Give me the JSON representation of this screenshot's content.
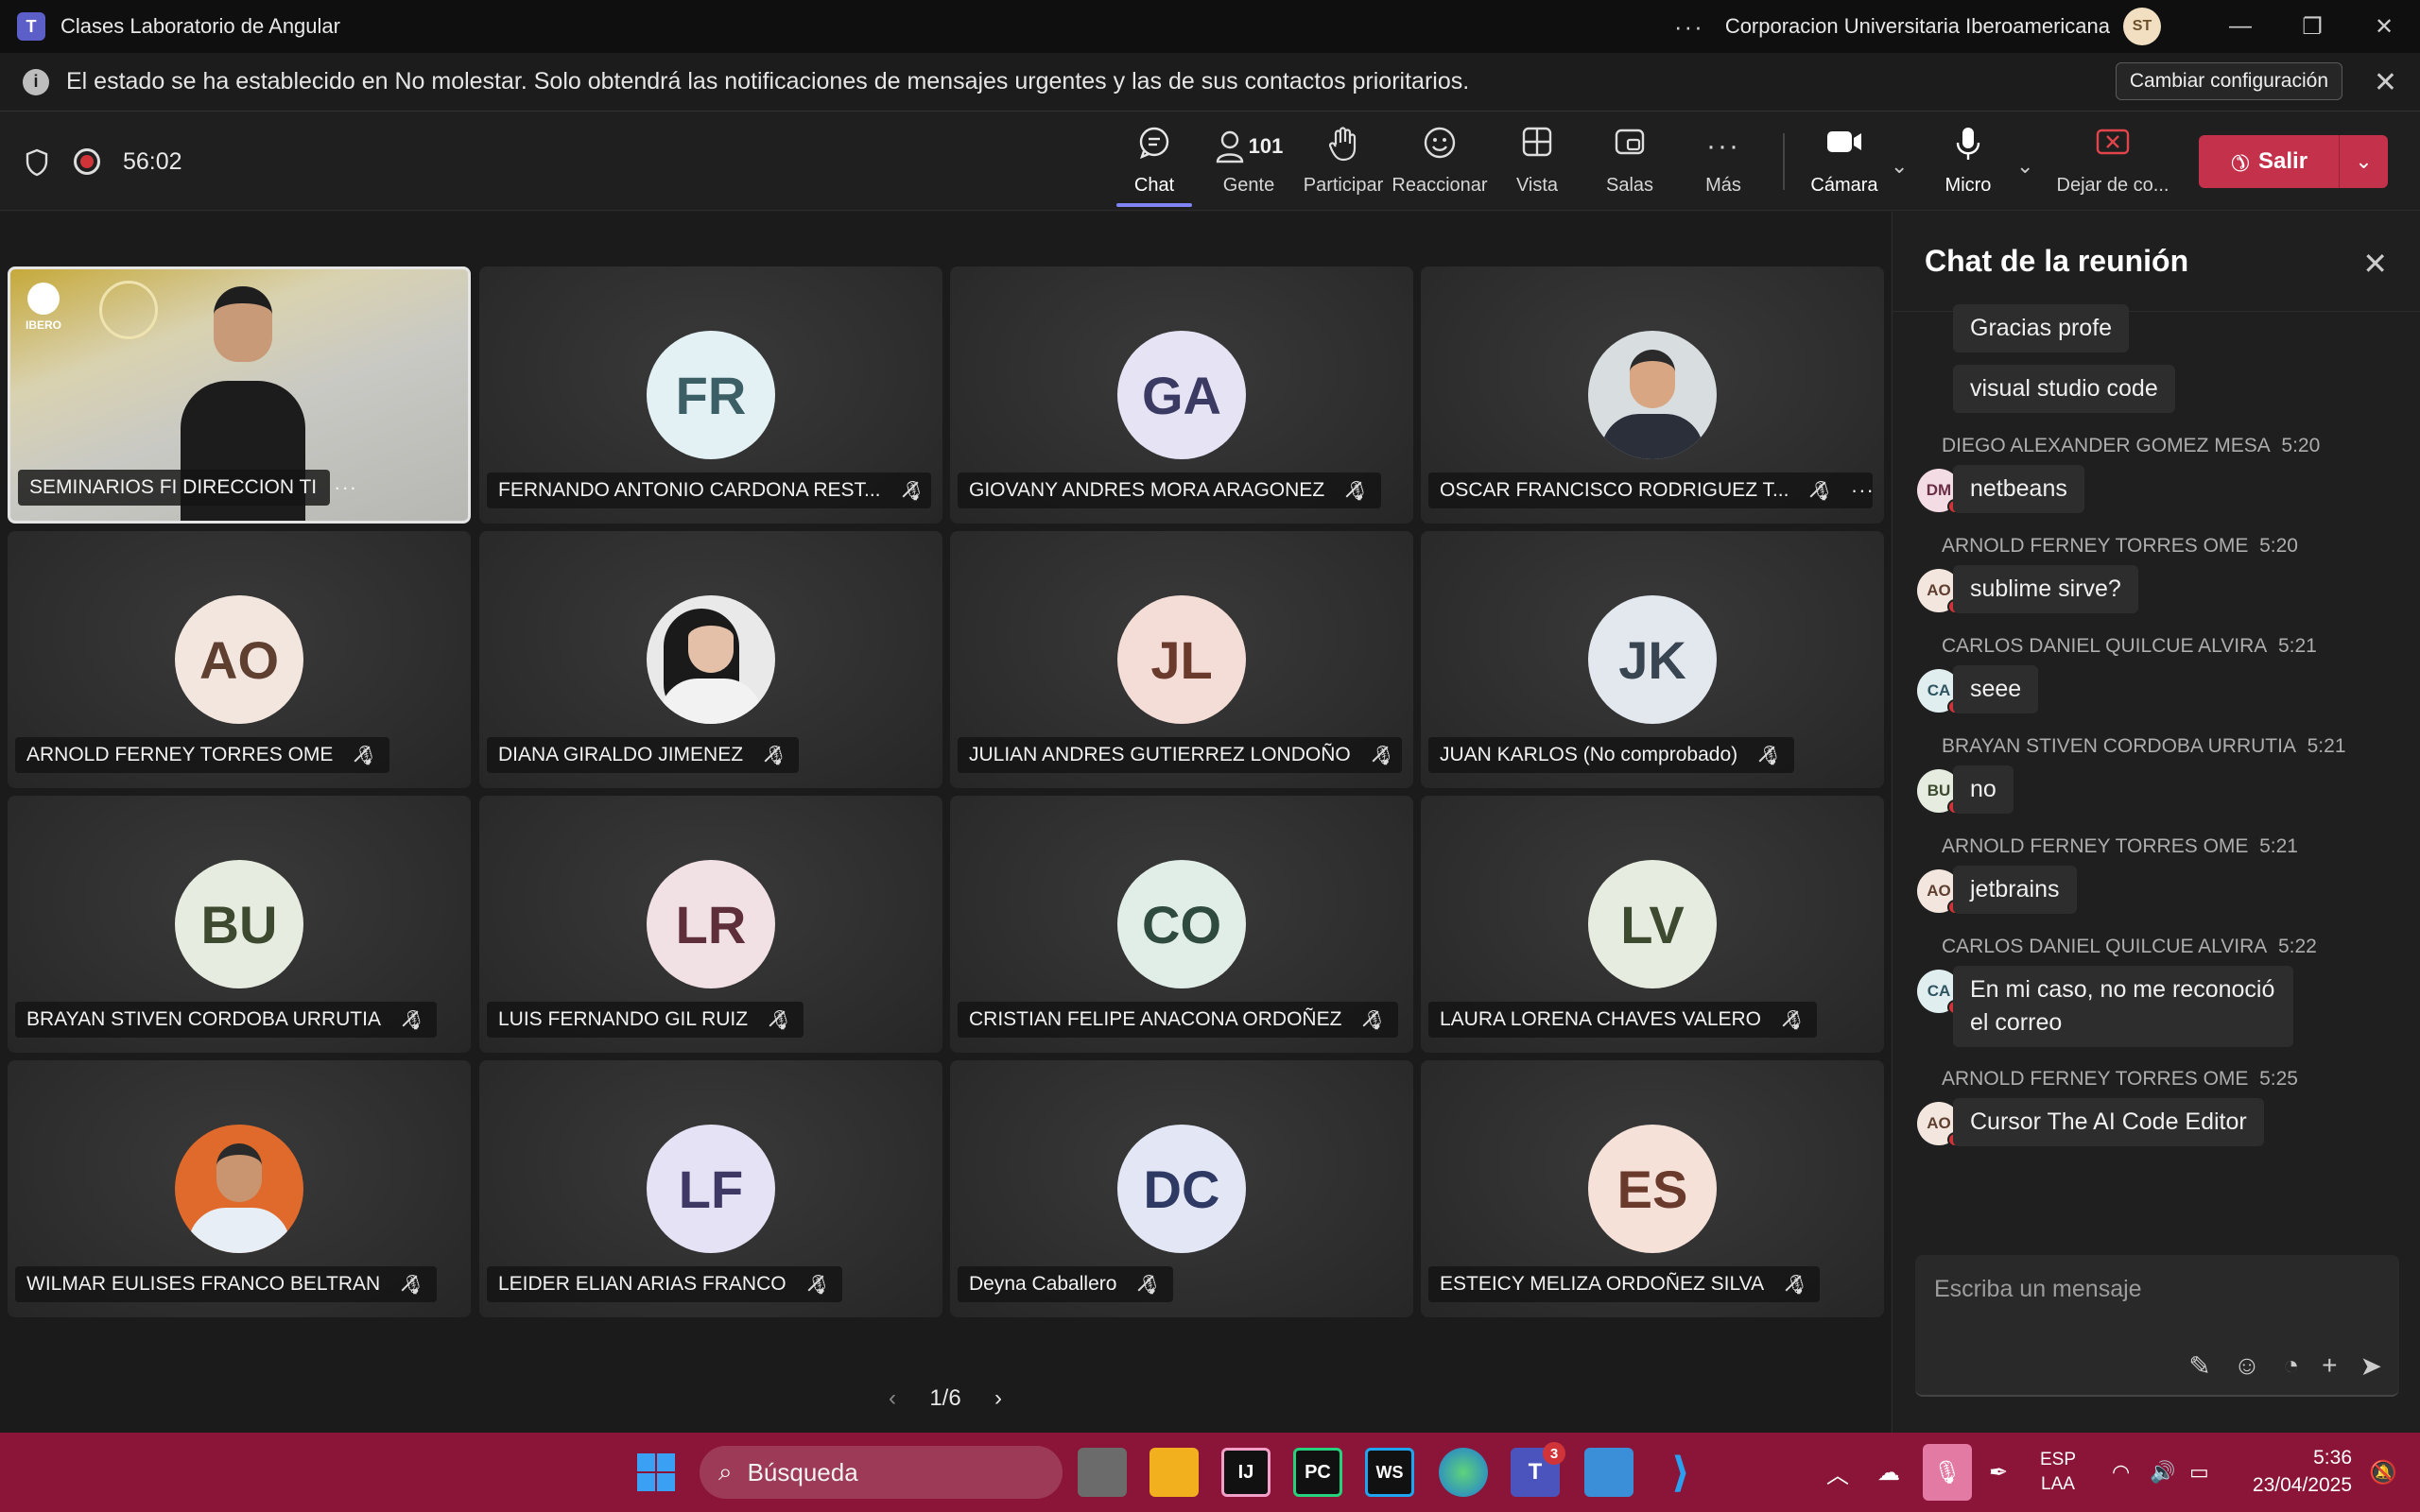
{
  "window": {
    "app_title": "Clases Laboratorio de Angular",
    "more": "···",
    "org": "Corporacion Universitaria Iberoamericana",
    "user_initials": "ST",
    "minimize": "—",
    "restore": "❐",
    "close": "✕"
  },
  "notice": {
    "text": "El estado se ha establecido en No molestar. Solo obtendrá las notificaciones de mensajes urgentes y las de sus contactos prioritarios.",
    "button": "Cambiar configuración",
    "close": "✕"
  },
  "toolbar": {
    "timer": "56:02",
    "chat": "Chat",
    "people": "Gente",
    "people_count": "101",
    "raise": "Participar",
    "react": "Reaccionar",
    "view": "Vista",
    "rooms": "Salas",
    "more": "Más",
    "camera": "Cámara",
    "mic": "Micro",
    "share": "Dejar de co...",
    "leave": "Salir"
  },
  "participants": [
    {
      "name": "SEMINARIOS FI DIRECCION TI",
      "initials": "",
      "photo": "room",
      "mic_off": false,
      "more": true
    },
    {
      "name": "FERNANDO ANTONIO CARDONA REST...",
      "initials": "FR",
      "bg": "#e3f1f4",
      "fg": "#3c5f66",
      "mic_off": true
    },
    {
      "name": "GIOVANY ANDRES MORA ARAGONEZ",
      "initials": "GA",
      "bg": "#e5e3f4",
      "fg": "#3b3a63",
      "mic_off": true
    },
    {
      "name": "OSCAR FRANCISCO RODRIGUEZ T...",
      "initials": "",
      "photo": "man-suit",
      "mic_off": true,
      "more": true
    },
    {
      "name": "ARNOLD FERNEY TORRES OME",
      "initials": "AO",
      "bg": "#f3e6de",
      "fg": "#5f3f30",
      "mic_off": true
    },
    {
      "name": "DIANA GIRALDO JIMENEZ",
      "initials": "",
      "photo": "woman",
      "mic_off": true
    },
    {
      "name": "JULIAN ANDRES GUTIERREZ LONDOÑO",
      "initials": "JL",
      "bg": "#f4ddd6",
      "fg": "#6a3a2c",
      "mic_off": true
    },
    {
      "name": "JUAN KARLOS (No comprobado)",
      "initials": "JK",
      "bg": "#e2e8ee",
      "fg": "#3a4552",
      "mic_off": true
    },
    {
      "name": "BRAYAN STIVEN CORDOBA URRUTIA",
      "initials": "BU",
      "bg": "#e6ecdf",
      "fg": "#3d4a2f",
      "mic_off": true
    },
    {
      "name": "LUIS FERNANDO GIL RUIZ",
      "initials": "LR",
      "bg": "#f1e0e4",
      "fg": "#5e2f3b",
      "mic_off": true
    },
    {
      "name": "CRISTIAN FELIPE ANACONA ORDOÑEZ",
      "initials": "CO",
      "bg": "#e1eee8",
      "fg": "#2f4a3f",
      "mic_off": true
    },
    {
      "name": "LAURA LORENA CHAVES VALERO",
      "initials": "LV",
      "bg": "#e6ecdf",
      "fg": "#3d4a2f",
      "mic_off": true
    },
    {
      "name": "WILMAR EULISES FRANCO BELTRAN",
      "initials": "",
      "photo": "man-orange",
      "mic_off": true
    },
    {
      "name": "LEIDER ELIAN ARIAS FRANCO",
      "initials": "LF",
      "bg": "#e6e2f6",
      "fg": "#3e3865",
      "mic_off": true
    },
    {
      "name": "Deyna Caballero",
      "initials": "DC",
      "bg": "#e2e6f5",
      "fg": "#2e3a63",
      "mic_off": true
    },
    {
      "name": "ESTEICY MELIZA ORDOÑEZ SILVA",
      "initials": "ES",
      "bg": "#f5e1d8",
      "fg": "#6a3a2c",
      "mic_off": true
    }
  ],
  "pager": {
    "label": "1/6",
    "prev": "‹",
    "next": "›"
  },
  "chat": {
    "title": "Chat de la reunión",
    "close": "✕",
    "messages": [
      {
        "text": "Gracias profe"
      },
      {
        "text": "visual studio code"
      },
      {
        "author": "DIEGO ALEXANDER GOMEZ MESA",
        "time": "5:20",
        "initials": "DM",
        "text": "netbeans"
      },
      {
        "author": "ARNOLD FERNEY TORRES OME",
        "time": "5:20",
        "initials": "AO",
        "text": "sublime sirve?"
      },
      {
        "author": "CARLOS DANIEL QUILCUE ALVIRA",
        "time": "5:21",
        "initials": "CA",
        "text": "seee"
      },
      {
        "author": "BRAYAN STIVEN CORDOBA URRUTIA",
        "time": "5:21",
        "initials": "BU",
        "text": "no"
      },
      {
        "author": "ARNOLD FERNEY TORRES OME",
        "time": "5:21",
        "initials": "AO",
        "text": "jetbrains"
      },
      {
        "author": "CARLOS DANIEL QUILCUE ALVIRA",
        "time": "5:22",
        "initials": "CA",
        "text": "En mi caso, no me reconoció el correo"
      },
      {
        "author": "ARNOLD FERNEY TORRES OME",
        "time": "5:25",
        "initials": "AO",
        "text": "Cursor The AI Code Editor"
      }
    ],
    "placeholder": "Escriba un mensaje"
  },
  "taskbar": {
    "search": "Búsqueda",
    "teams_badge": "3",
    "lang1": "ESP",
    "lang2": "LAA",
    "time": "5:36",
    "date": "23/04/2025"
  }
}
